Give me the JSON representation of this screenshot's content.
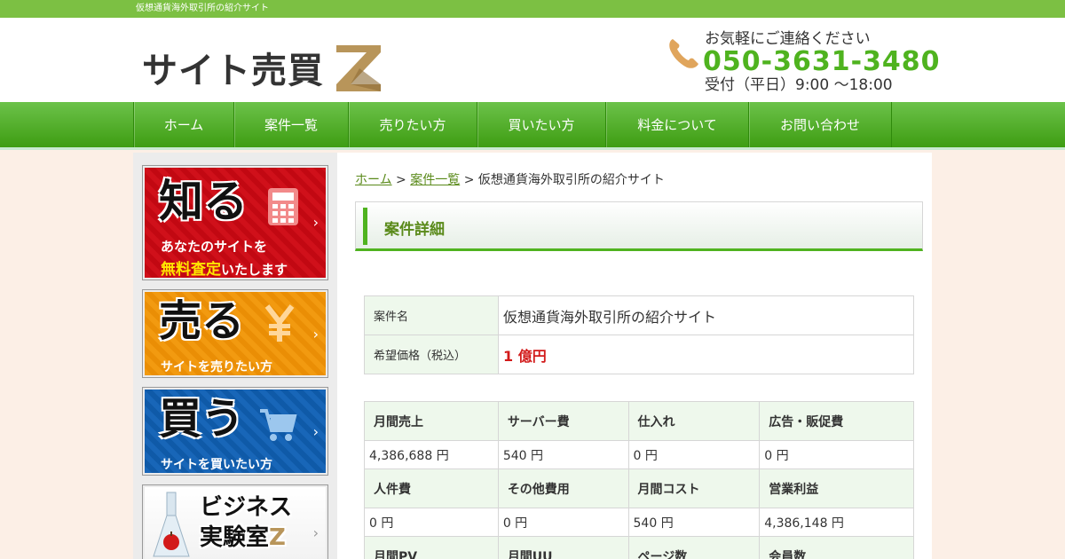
{
  "topbar": {
    "tagline": "仮想通貨海外取引所の紹介サイト"
  },
  "header": {
    "logo_text": "サイト売買",
    "logo_letter": "Z",
    "contact_lead": "お気軽にご連絡ください",
    "tel": "050-3631-3480",
    "hours": "受付（平日）9:00 ～18:00"
  },
  "nav": {
    "items": [
      {
        "label": "ホーム"
      },
      {
        "label": "案件一覧"
      },
      {
        "label": "売りたい方"
      },
      {
        "label": "買いたい方"
      },
      {
        "label": "料金について"
      },
      {
        "label": "お問い合わせ"
      }
    ]
  },
  "sidebar": {
    "banners": [
      {
        "big": "知る",
        "line1": "あなたのサイトを",
        "line2_strong": "無料査定",
        "line2_rest": "いたします"
      },
      {
        "big": "売る",
        "line1": "サイトを売りたい方"
      },
      {
        "big": "買う",
        "line1": "サイトを買いたい方"
      },
      {
        "line1": "ビジネス",
        "line2": "実験室",
        "line2_letter": "Z"
      }
    ]
  },
  "breadcrumb": {
    "home": "ホーム",
    "list": "案件一覧",
    "sep": ">",
    "current": "仮想通貨海外取引所の紹介サイト"
  },
  "section": {
    "title": "案件詳細"
  },
  "summary": {
    "name_label": "案件名",
    "name_value": "仮想通貨海外取引所の紹介サイト",
    "price_label": "希望価格（税込）",
    "price_value": "1 億円"
  },
  "details": {
    "rows": [
      {
        "headers": [
          "月間売上",
          "サーバー費",
          "仕入れ",
          "広告・販促費"
        ],
        "values": [
          "4,386,688 円",
          "540 円",
          "0 円",
          "0 円"
        ]
      },
      {
        "headers": [
          "人件費",
          "その他費用",
          "月間コスト",
          "営業利益"
        ],
        "values": [
          "0 円",
          "0 円",
          "540 円",
          "4,386,148 円"
        ]
      },
      {
        "headers": [
          "月間PV",
          "月間UU",
          "ページ数",
          "会員数"
        ],
        "values": [
          "",
          "",
          "",
          ""
        ]
      }
    ]
  },
  "colors": {
    "brand_green": "#4fb31f",
    "price_red": "#d21a1a",
    "logo_gold": "#b8955a"
  }
}
